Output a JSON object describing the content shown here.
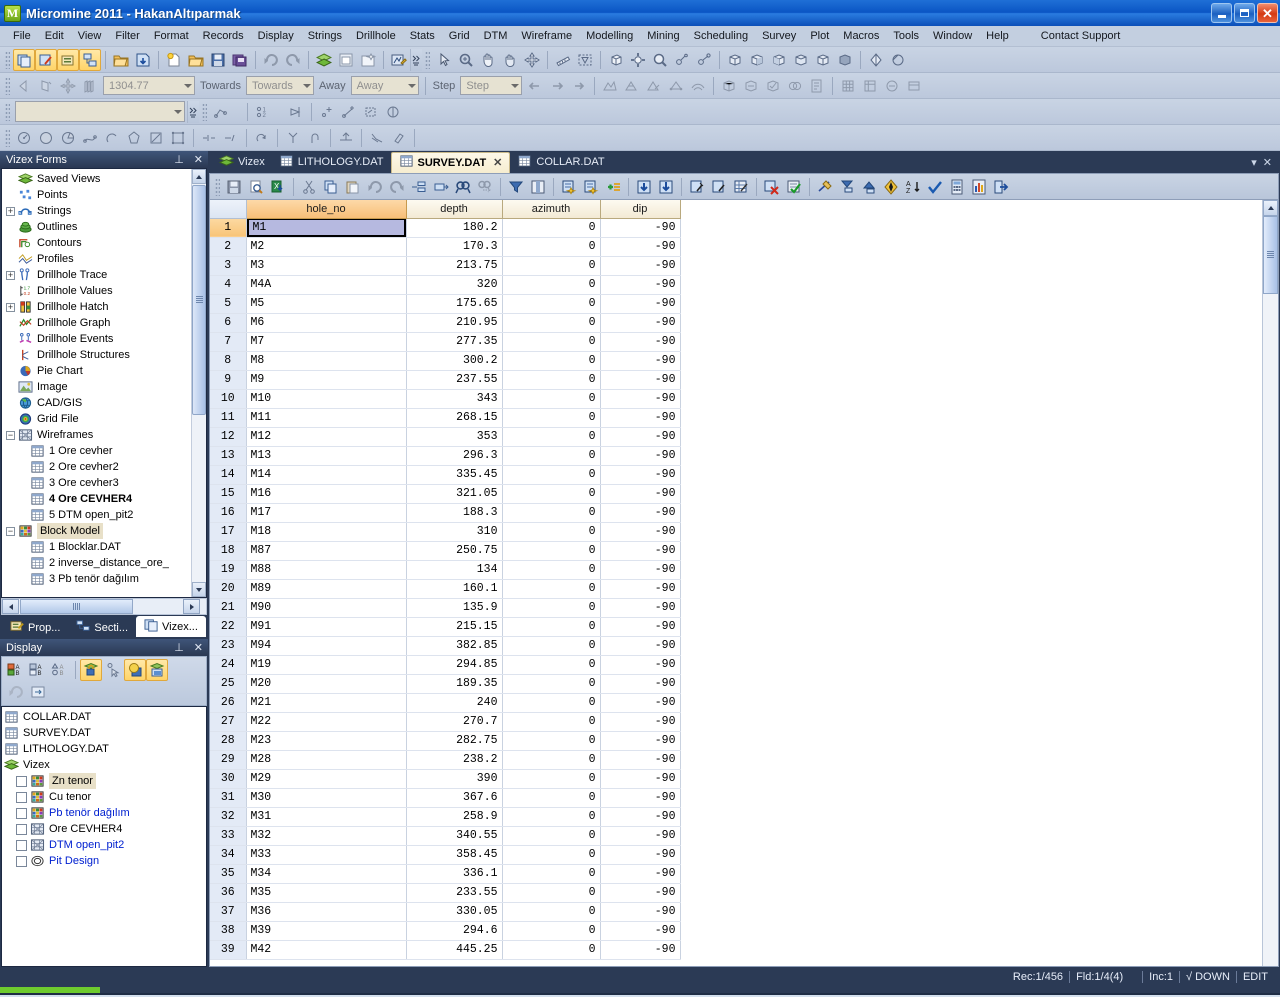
{
  "window": {
    "title": "Micromine 2011 - HakanAltıparmak",
    "app_badge": "M",
    "buttons": {
      "minimize": "minimize-button",
      "maximize": "maximize-button",
      "close": "close-button"
    }
  },
  "menubar": {
    "items": [
      "File",
      "Edit",
      "View",
      "Filter",
      "Format",
      "Records",
      "Display",
      "Strings",
      "Drillhole",
      "Stats",
      "Grid",
      "DTM",
      "Wireframe",
      "Modelling",
      "Mining",
      "Scheduling",
      "Survey",
      "Plot",
      "Macros",
      "Tools",
      "Window",
      "Help"
    ],
    "extra": "Contact Support"
  },
  "toolbar2": {
    "value_combo": "1304.77",
    "towards_label": "Towards",
    "towards_combo": "Towards",
    "away_label": "Away",
    "away_combo": "Away",
    "step_label": "Step",
    "step_combo": "Step"
  },
  "toolbar3": {
    "form_combo": ""
  },
  "vizex_panel": {
    "title": "Vizex Forms",
    "pin_icon": "pin-icon",
    "close_icon": "close-icon",
    "tree": [
      {
        "label": "Saved Views",
        "icon": "layers-icon",
        "expander": "none",
        "indent": 1
      },
      {
        "label": "Points",
        "icon": "points-icon",
        "expander": "none",
        "indent": 1
      },
      {
        "label": "Strings",
        "icon": "strings-icon",
        "expander": "plus",
        "indent": 1
      },
      {
        "label": "Outlines",
        "icon": "outlines-icon",
        "expander": "none",
        "indent": 1
      },
      {
        "label": "Contours",
        "icon": "contours-icon",
        "expander": "none",
        "indent": 1
      },
      {
        "label": "Profiles",
        "icon": "profiles-icon",
        "expander": "none",
        "indent": 1
      },
      {
        "label": "Drillhole Trace",
        "icon": "drillhole-trace-icon",
        "expander": "plus",
        "indent": 1
      },
      {
        "label": "Drillhole Values",
        "icon": "drillhole-values-icon",
        "expander": "none",
        "indent": 1
      },
      {
        "label": "Drillhole Hatch",
        "icon": "drillhole-hatch-icon",
        "expander": "plus",
        "indent": 1
      },
      {
        "label": "Drillhole Graph",
        "icon": "drillhole-graph-icon",
        "expander": "none",
        "indent": 1
      },
      {
        "label": "Drillhole Events",
        "icon": "drillhole-events-icon",
        "expander": "none",
        "indent": 1
      },
      {
        "label": "Drillhole Structures",
        "icon": "drillhole-structures-icon",
        "expander": "none",
        "indent": 1
      },
      {
        "label": "Pie Chart",
        "icon": "pie-chart-icon",
        "expander": "none",
        "indent": 1
      },
      {
        "label": "Image",
        "icon": "image-icon",
        "expander": "none",
        "indent": 1
      },
      {
        "label": "CAD/GIS",
        "icon": "globe-icon",
        "expander": "none",
        "indent": 1
      },
      {
        "label": "Grid File",
        "icon": "grid-file-icon",
        "expander": "none",
        "indent": 1
      },
      {
        "label": "Wireframes",
        "icon": "wireframe-icon",
        "expander": "minus",
        "indent": 1
      },
      {
        "label": "1 Ore cevher",
        "icon": "table-icon",
        "expander": "none",
        "indent": 2
      },
      {
        "label": "2 Ore cevher2",
        "icon": "table-icon",
        "expander": "none",
        "indent": 2
      },
      {
        "label": "3 Ore cevher3",
        "icon": "table-icon",
        "expander": "none",
        "indent": 2
      },
      {
        "label": "4 Ore CEVHER4",
        "icon": "table-icon",
        "expander": "none",
        "indent": 2,
        "bold": true
      },
      {
        "label": "5 DTM open_pit2",
        "icon": "table-icon",
        "expander": "none",
        "indent": 2
      },
      {
        "label": "Block Model",
        "icon": "block-model-icon",
        "expander": "minus",
        "indent": 1,
        "selected": true
      },
      {
        "label": "1 Blocklar.DAT",
        "icon": "table-icon",
        "expander": "none",
        "indent": 2
      },
      {
        "label": "2 inverse_distance_ore_",
        "icon": "table-icon",
        "expander": "none",
        "indent": 2
      },
      {
        "label": "3 Pb tenör dağılım",
        "icon": "table-icon",
        "expander": "none",
        "indent": 2
      }
    ]
  },
  "panel_tabs": [
    {
      "label": "Prop...",
      "icon": "properties-icon",
      "active": false
    },
    {
      "label": "Secti...",
      "icon": "sections-icon",
      "active": false
    },
    {
      "label": "Vizex...",
      "icon": "vizex-icon",
      "active": true
    }
  ],
  "display_panel": {
    "title": "Display",
    "pin_icon": "pin-icon",
    "close_icon": "close-icon",
    "tools_row1": [
      "display-ab-colors-icon",
      "display-ab-table-icon",
      "display-ab-circle-icon",
      "lock-layer-icon",
      "pointer-select-icon",
      "transparency-icon",
      "layers-display-icon"
    ],
    "tools_row2": [
      "undo-icon",
      "refresh-icon"
    ],
    "items": [
      {
        "label": "COLLAR.DAT",
        "icon": "table-icon",
        "checkbox": false,
        "indent": 0
      },
      {
        "label": "SURVEY.DAT",
        "icon": "table-icon",
        "checkbox": false,
        "indent": 0
      },
      {
        "label": "LITHOLOGY.DAT",
        "icon": "table-icon",
        "checkbox": false,
        "indent": 0
      },
      {
        "label": "Vizex",
        "icon": "layers-icon",
        "checkbox": false,
        "indent": 0
      },
      {
        "label": "Zn tenor",
        "icon": "block-model-icon",
        "checkbox": true,
        "indent": 1,
        "selected": true
      },
      {
        "label": "Cu tenor",
        "icon": "block-model-icon",
        "checkbox": true,
        "indent": 1
      },
      {
        "label": "Pb tenör dağılım",
        "icon": "block-model-icon",
        "checkbox": true,
        "indent": 1,
        "blue": true
      },
      {
        "label": "Ore CEVHER4",
        "icon": "wireframe-icon",
        "checkbox": true,
        "indent": 1
      },
      {
        "label": "DTM open_pit2",
        "icon": "wireframe-icon",
        "checkbox": true,
        "indent": 1,
        "blue": true
      },
      {
        "label": "Pit Design",
        "icon": "pit-design-icon",
        "checkbox": true,
        "indent": 1,
        "blue": true
      }
    ]
  },
  "doc_tabs": [
    {
      "label": "Vizex",
      "icon": "layers-icon",
      "active": false,
      "closable": false
    },
    {
      "label": "LITHOLOGY.DAT",
      "icon": "table-icon",
      "active": false,
      "closable": false
    },
    {
      "label": "SURVEY.DAT",
      "icon": "table-icon",
      "active": true,
      "closable": true,
      "close_glyph": "✕"
    },
    {
      "label": "COLLAR.DAT",
      "icon": "table-icon",
      "active": false,
      "closable": false
    }
  ],
  "doc_tabs_right": {
    "dropdown_icon": "chevron-down-icon",
    "close_icon": "close-icon"
  },
  "grid_toolbar": {
    "group1": [
      "save-icon",
      "print-preview-icon",
      "export-excel-icon"
    ],
    "group2": [
      "cut-icon",
      "copy-icon",
      "paste-icon",
      "undo-icon",
      "redo-icon",
      "insert-column-icon",
      "delete-column-icon",
      "find-icon",
      "find-next-icon"
    ],
    "group3": [
      "filter-icon",
      "column-select-icon"
    ],
    "group4": [
      "insert-record-icon",
      "insert-record-after-icon",
      "add-field-icon"
    ],
    "group5": [
      "move-down-icon",
      "move-bottom-icon"
    ],
    "group6": [
      "field-properties-icon",
      "field-edit-icon",
      "field-format-icon"
    ],
    "group7": [
      "delete-record-icon",
      "validate-icon"
    ],
    "group8": [
      "measure-icon",
      "import-icon",
      "export-icon",
      "compass-icon",
      "sort-az-icon",
      "check-icon",
      "calculator-icon",
      "stats-chart-icon",
      "exit-icon"
    ]
  },
  "grid": {
    "columns": [
      "",
      "hole_no",
      "depth",
      "azimuth",
      "dip"
    ],
    "selected_cell": {
      "row": 1,
      "column": "hole_no",
      "value": "M1"
    },
    "rows": [
      {
        "n": 1,
        "hole_no": "M1",
        "depth": "180.2",
        "azimuth": "0",
        "dip": "-90"
      },
      {
        "n": 2,
        "hole_no": "M2",
        "depth": "170.3",
        "azimuth": "0",
        "dip": "-90"
      },
      {
        "n": 3,
        "hole_no": "M3",
        "depth": "213.75",
        "azimuth": "0",
        "dip": "-90"
      },
      {
        "n": 4,
        "hole_no": "M4A",
        "depth": "320",
        "azimuth": "0",
        "dip": "-90"
      },
      {
        "n": 5,
        "hole_no": "M5",
        "depth": "175.65",
        "azimuth": "0",
        "dip": "-90"
      },
      {
        "n": 6,
        "hole_no": "M6",
        "depth": "210.95",
        "azimuth": "0",
        "dip": "-90"
      },
      {
        "n": 7,
        "hole_no": "M7",
        "depth": "277.35",
        "azimuth": "0",
        "dip": "-90"
      },
      {
        "n": 8,
        "hole_no": "M8",
        "depth": "300.2",
        "azimuth": "0",
        "dip": "-90"
      },
      {
        "n": 9,
        "hole_no": "M9",
        "depth": "237.55",
        "azimuth": "0",
        "dip": "-90"
      },
      {
        "n": 10,
        "hole_no": "M10",
        "depth": "343",
        "azimuth": "0",
        "dip": "-90"
      },
      {
        "n": 11,
        "hole_no": "M11",
        "depth": "268.15",
        "azimuth": "0",
        "dip": "-90"
      },
      {
        "n": 12,
        "hole_no": "M12",
        "depth": "353",
        "azimuth": "0",
        "dip": "-90"
      },
      {
        "n": 13,
        "hole_no": "M13",
        "depth": "296.3",
        "azimuth": "0",
        "dip": "-90"
      },
      {
        "n": 14,
        "hole_no": "M14",
        "depth": "335.45",
        "azimuth": "0",
        "dip": "-90"
      },
      {
        "n": 15,
        "hole_no": "M16",
        "depth": "321.05",
        "azimuth": "0",
        "dip": "-90"
      },
      {
        "n": 16,
        "hole_no": "M17",
        "depth": "188.3",
        "azimuth": "0",
        "dip": "-90"
      },
      {
        "n": 17,
        "hole_no": "M18",
        "depth": "310",
        "azimuth": "0",
        "dip": "-90"
      },
      {
        "n": 18,
        "hole_no": "M87",
        "depth": "250.75",
        "azimuth": "0",
        "dip": "-90"
      },
      {
        "n": 19,
        "hole_no": "M88",
        "depth": "134",
        "azimuth": "0",
        "dip": "-90"
      },
      {
        "n": 20,
        "hole_no": "M89",
        "depth": "160.1",
        "azimuth": "0",
        "dip": "-90"
      },
      {
        "n": 21,
        "hole_no": "M90",
        "depth": "135.9",
        "azimuth": "0",
        "dip": "-90"
      },
      {
        "n": 22,
        "hole_no": "M91",
        "depth": "215.15",
        "azimuth": "0",
        "dip": "-90"
      },
      {
        "n": 23,
        "hole_no": "M94",
        "depth": "382.85",
        "azimuth": "0",
        "dip": "-90"
      },
      {
        "n": 24,
        "hole_no": "M19",
        "depth": "294.85",
        "azimuth": "0",
        "dip": "-90"
      },
      {
        "n": 25,
        "hole_no": "M20",
        "depth": "189.35",
        "azimuth": "0",
        "dip": "-90"
      },
      {
        "n": 26,
        "hole_no": "M21",
        "depth": "240",
        "azimuth": "0",
        "dip": "-90"
      },
      {
        "n": 27,
        "hole_no": "M22",
        "depth": "270.7",
        "azimuth": "0",
        "dip": "-90"
      },
      {
        "n": 28,
        "hole_no": "M23",
        "depth": "282.75",
        "azimuth": "0",
        "dip": "-90"
      },
      {
        "n": 29,
        "hole_no": "M28",
        "depth": "238.2",
        "azimuth": "0",
        "dip": "-90"
      },
      {
        "n": 30,
        "hole_no": "M29",
        "depth": "390",
        "azimuth": "0",
        "dip": "-90"
      },
      {
        "n": 31,
        "hole_no": "M30",
        "depth": "367.6",
        "azimuth": "0",
        "dip": "-90"
      },
      {
        "n": 32,
        "hole_no": "M31",
        "depth": "258.9",
        "azimuth": "0",
        "dip": "-90"
      },
      {
        "n": 33,
        "hole_no": "M32",
        "depth": "340.55",
        "azimuth": "0",
        "dip": "-90"
      },
      {
        "n": 34,
        "hole_no": "M33",
        "depth": "358.45",
        "azimuth": "0",
        "dip": "-90"
      },
      {
        "n": 35,
        "hole_no": "M34",
        "depth": "336.1",
        "azimuth": "0",
        "dip": "-90"
      },
      {
        "n": 36,
        "hole_no": "M35",
        "depth": "233.55",
        "azimuth": "0",
        "dip": "-90"
      },
      {
        "n": 37,
        "hole_no": "M36",
        "depth": "330.05",
        "azimuth": "0",
        "dip": "-90"
      },
      {
        "n": 38,
        "hole_no": "M39",
        "depth": "294.6",
        "azimuth": "0",
        "dip": "-90"
      },
      {
        "n": 39,
        "hole_no": "M42",
        "depth": "445.25",
        "azimuth": "0",
        "dip": "-90"
      }
    ]
  },
  "statusbar": {
    "record": "Rec:1/456",
    "field": "Fld:1/4(4)",
    "blank": "",
    "increment": "Inc:1",
    "direction": "DOWN",
    "direction_icon": "down-arrow-icon",
    "mode": "EDIT"
  }
}
